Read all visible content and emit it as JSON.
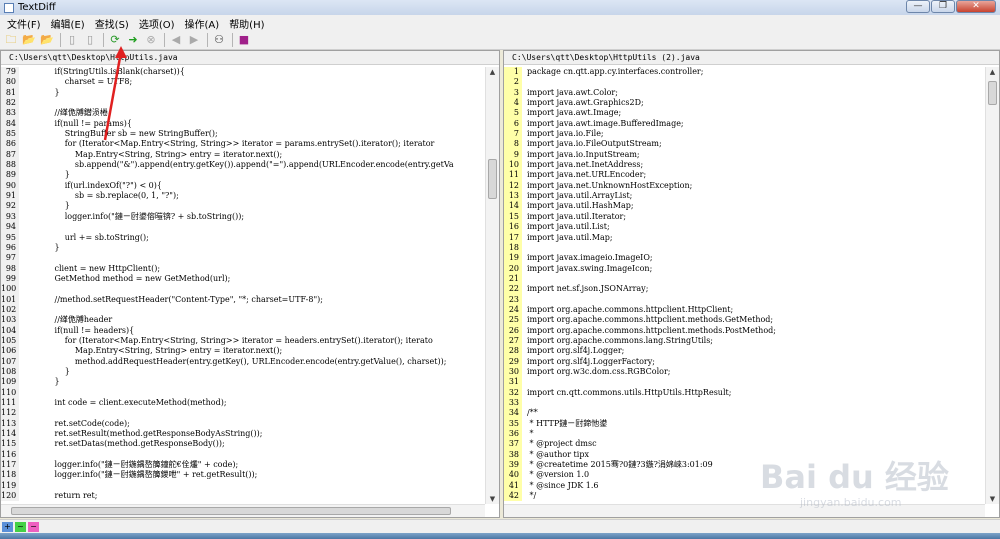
{
  "window": {
    "title": "TextDiff",
    "minimize": "—",
    "restore": "❐",
    "close": "✕"
  },
  "menu": [
    "文件(F)",
    "编辑(E)",
    "查找(S)",
    "选项(O)",
    "操作(A)",
    "帮助(H)"
  ],
  "toolbar_icons": [
    {
      "name": "open-icon",
      "glyph": "🗀",
      "color": "#e0b020"
    },
    {
      "name": "open-left-icon",
      "glyph": "📂",
      "color": "#e09020"
    },
    {
      "name": "open-right-icon",
      "glyph": "📂",
      "color": "#e09020"
    },
    {
      "sep": true
    },
    {
      "name": "save-left-icon",
      "glyph": "▯",
      "color": "#999999"
    },
    {
      "name": "save-right-icon",
      "glyph": "▯",
      "color": "#999999"
    },
    {
      "sep": true
    },
    {
      "name": "refresh-icon",
      "glyph": "⟳",
      "color": "#2a9a2a"
    },
    {
      "name": "compare-go-icon",
      "glyph": "➜",
      "color": "#1f9e1f"
    },
    {
      "name": "stop-icon",
      "glyph": "⊗",
      "color": "#aaaaaa"
    },
    {
      "sep": true
    },
    {
      "name": "prev-diff-icon",
      "glyph": "◀",
      "color": "#aaaaaa"
    },
    {
      "name": "next-diff-icon",
      "glyph": "▶",
      "color": "#aaaaaa"
    },
    {
      "sep": true
    },
    {
      "name": "binoculars-icon",
      "glyph": "⚇",
      "color": "#333333"
    },
    {
      "sep": true
    },
    {
      "name": "help-book-icon",
      "glyph": "■",
      "color": "#a0208a"
    }
  ],
  "left": {
    "path": "C:\\Users\\qtt\\Desktop\\HttpUtils.java",
    "lines": [
      [
        "79",
        "            if(StringUtils.isBlank(charset)){"
      ],
      [
        "80",
        "                charset = UTF8;"
      ],
      [
        "81",
        "            }"
      ],
      [
        "82",
        ""
      ],
      [
        "83",
        "            //缂佹牔鐟涢棬"
      ],
      [
        "84",
        "            if(null != params){"
      ],
      [
        "85",
        "                StringBuffer sb = new StringBuffer();"
      ],
      [
        "86",
        "                for (Iterator<Map.Entry<String, String>> iterator = params.entrySet().iterator(); iterator"
      ],
      [
        "87",
        "                    Map.Entry<String, String> entry = iterator.next();"
      ],
      [
        "88",
        "                    sb.append(\"&\").append(entry.getKey()).append(\"=\").append(URLEncoder.encode(entry.getVa"
      ],
      [
        "89",
        "                }"
      ],
      [
        "90",
        "                if(url.indexOf(\"?\") < 0){"
      ],
      [
        "91",
        "                    sb = sb.replace(0, 1, \"?\");"
      ],
      [
        "92",
        "                }"
      ],
      [
        "93",
        "                logger.info(\"鏈ㄧ尀鍙傛暟锛? + sb.toString());"
      ],
      [
        "94",
        ""
      ],
      [
        "95",
        "                url += sb.toString();"
      ],
      [
        "96",
        "            }"
      ],
      [
        "97",
        ""
      ],
      [
        "98",
        "            client = new HttpClient();"
      ],
      [
        "99",
        "            GetMethod method = new GetMethod(url);"
      ],
      [
        "100",
        ""
      ],
      [
        "101",
        "            //method.setRequestHeader(\"Content-Type\", \"*; charset=UTF-8\");"
      ],
      [
        "102",
        ""
      ],
      [
        "103",
        "            //缂佹牔header"
      ],
      [
        "104",
        "            if(null != headers){"
      ],
      [
        "105",
        "                for (Iterator<Map.Entry<String, String>> iterator = headers.entrySet().iterator(); iterato"
      ],
      [
        "106",
        "                    Map.Entry<String, String> entry = iterator.next();"
      ],
      [
        "107",
        "                    method.addRequestHeader(entry.getKey(), URLEncoder.encode(entry.getValue(), charset));"
      ],
      [
        "108",
        "                }"
      ],
      [
        "109",
        "            }"
      ],
      [
        "110",
        ""
      ],
      [
        "111",
        "            int code = client.executeMethod(method);"
      ],
      [
        "112",
        ""
      ],
      [
        "113",
        "            ret.setCode(code);"
      ],
      [
        "114",
        "            ret.setResult(method.getResponseBodyAsString());"
      ],
      [
        "115",
        "            ret.setDatas(method.getResponseBody());"
      ],
      [
        "116",
        ""
      ],
      [
        "117",
        "            logger.info(\"鏈ㄧ尀鍦鍝嶅簲鐘舵€佺爜\" + code);"
      ],
      [
        "118",
        "            logger.info(\"鏈ㄧ尀鍦鍝嶅簲鍐呭\" + ret.getResult());"
      ],
      [
        "119",
        ""
      ],
      [
        "120",
        "            return ret;"
      ]
    ]
  },
  "right": {
    "path": "C:\\Users\\qtt\\Desktop\\HttpUtils (2).java",
    "lines": [
      [
        "1",
        "package cn.qtt.app.cy.interfaces.controller;"
      ],
      [
        "2",
        ""
      ],
      [
        "3",
        "import java.awt.Color;"
      ],
      [
        "4",
        "import java.awt.Graphics2D;"
      ],
      [
        "5",
        "import java.awt.Image;"
      ],
      [
        "6",
        "import java.awt.image.BufferedImage;"
      ],
      [
        "7",
        "import java.io.File;"
      ],
      [
        "8",
        "import java.io.FileOutputStream;"
      ],
      [
        "9",
        "import java.io.InputStream;"
      ],
      [
        "10",
        "import java.net.InetAddress;"
      ],
      [
        "11",
        "import java.net.URLEncoder;"
      ],
      [
        "12",
        "import java.net.UnknownHostException;"
      ],
      [
        "13",
        "import java.util.ArrayList;"
      ],
      [
        "14",
        "import java.util.HashMap;"
      ],
      [
        "15",
        "import java.util.Iterator;"
      ],
      [
        "16",
        "import java.util.List;"
      ],
      [
        "17",
        "import java.util.Map;"
      ],
      [
        "18",
        ""
      ],
      [
        "19",
        "import javax.imageio.ImageIO;"
      ],
      [
        "20",
        "import javax.swing.ImageIcon;"
      ],
      [
        "21",
        ""
      ],
      [
        "22",
        "import net.sf.json.JSONArray;"
      ],
      [
        "23",
        ""
      ],
      [
        "24",
        "import org.apache.commons.httpclient.HttpClient;"
      ],
      [
        "25",
        "import org.apache.commons.httpclient.methods.GetMethod;"
      ],
      [
        "26",
        "import org.apache.commons.httpclient.methods.PostMethod;"
      ],
      [
        "27",
        "import org.apache.commons.lang.StringUtils;"
      ],
      [
        "28",
        "import org.slf4j.Logger;"
      ],
      [
        "29",
        "import org.slf4j.LoggerFactory;"
      ],
      [
        "30",
        "import org.w3c.dom.css.RGBColor;"
      ],
      [
        "31",
        ""
      ],
      [
        "32",
        "import cn.qtt.commons.utils.HttpUtils.HttpResult;"
      ],
      [
        "33",
        ""
      ],
      [
        "34",
        "/**"
      ],
      [
        "35",
        " * HTTP鏈ㄧ尀鍗忚鍙"
      ],
      [
        "36",
        " *"
      ],
      [
        "37",
        " * @project dmsc"
      ],
      [
        "38",
        " * @author tipx"
      ],
      [
        "39",
        " * @createtime 2015骞?0鏈?3鏃?涓婂崍3:01:09"
      ],
      [
        "40",
        " * @version 1.0"
      ],
      [
        "41",
        " * @since JDK 1.6"
      ],
      [
        "42",
        " */"
      ]
    ]
  },
  "status": [
    {
      "name": "status-mark-add",
      "glyph": "+",
      "color": "#5a8fd8"
    },
    {
      "name": "status-mark-change",
      "glyph": "~",
      "color": "#45d045"
    },
    {
      "name": "status-mark-delete",
      "glyph": "−",
      "color": "#ee60c0"
    }
  ],
  "watermark": {
    "brand": "Bai du 经验",
    "url": "jingyan.baidu.com"
  }
}
